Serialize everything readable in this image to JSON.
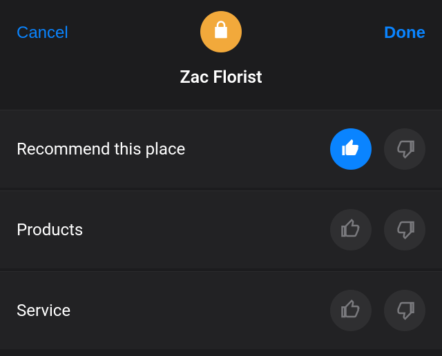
{
  "header": {
    "cancel_label": "Cancel",
    "done_label": "Done",
    "title": "Zac Florist",
    "avatar_color": "#f2a93b"
  },
  "rows": [
    {
      "label": "Recommend this place",
      "up_active": true,
      "down_active": false
    },
    {
      "label": "Products",
      "up_active": false,
      "down_active": false
    },
    {
      "label": "Service",
      "up_active": false,
      "down_active": false
    }
  ]
}
